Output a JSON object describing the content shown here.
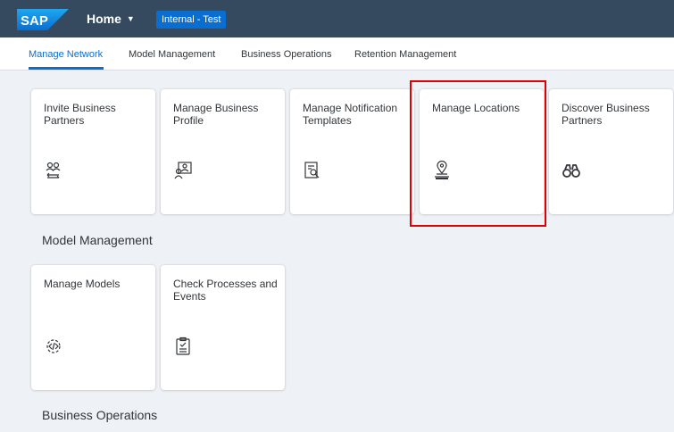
{
  "shell": {
    "logo_text": "SAP",
    "home_label": "Home",
    "environment_badge": "Internal - Test",
    "colors": {
      "shell_bg": "#354a5f",
      "accent": "#0a6ed1",
      "highlight": "#e00000"
    }
  },
  "tabs": [
    {
      "label": "Manage Network",
      "active": true
    },
    {
      "label": "Model Management",
      "active": false
    },
    {
      "label": "Business Operations",
      "active": false
    },
    {
      "label": "Retention Management",
      "active": false
    }
  ],
  "groups": {
    "manage_network": {
      "tiles": [
        {
          "title": "Invite Business Partners",
          "icon": "invite-partners-icon"
        },
        {
          "title": "Manage Business Profile",
          "icon": "business-profile-icon"
        },
        {
          "title": "Manage Notification Templates",
          "icon": "notification-template-icon"
        },
        {
          "title": "Manage Locations",
          "icon": "location-pin-icon"
        },
        {
          "title": "Discover Business Partners",
          "icon": "binoculars-icon"
        }
      ]
    },
    "model_management": {
      "title": "Model Management",
      "tiles": [
        {
          "title": "Manage Models",
          "icon": "model-gear-code-icon"
        },
        {
          "title": "Check Processes and Events",
          "icon": "clipboard-check-icon"
        }
      ]
    },
    "business_operations": {
      "title": "Business Operations"
    }
  }
}
